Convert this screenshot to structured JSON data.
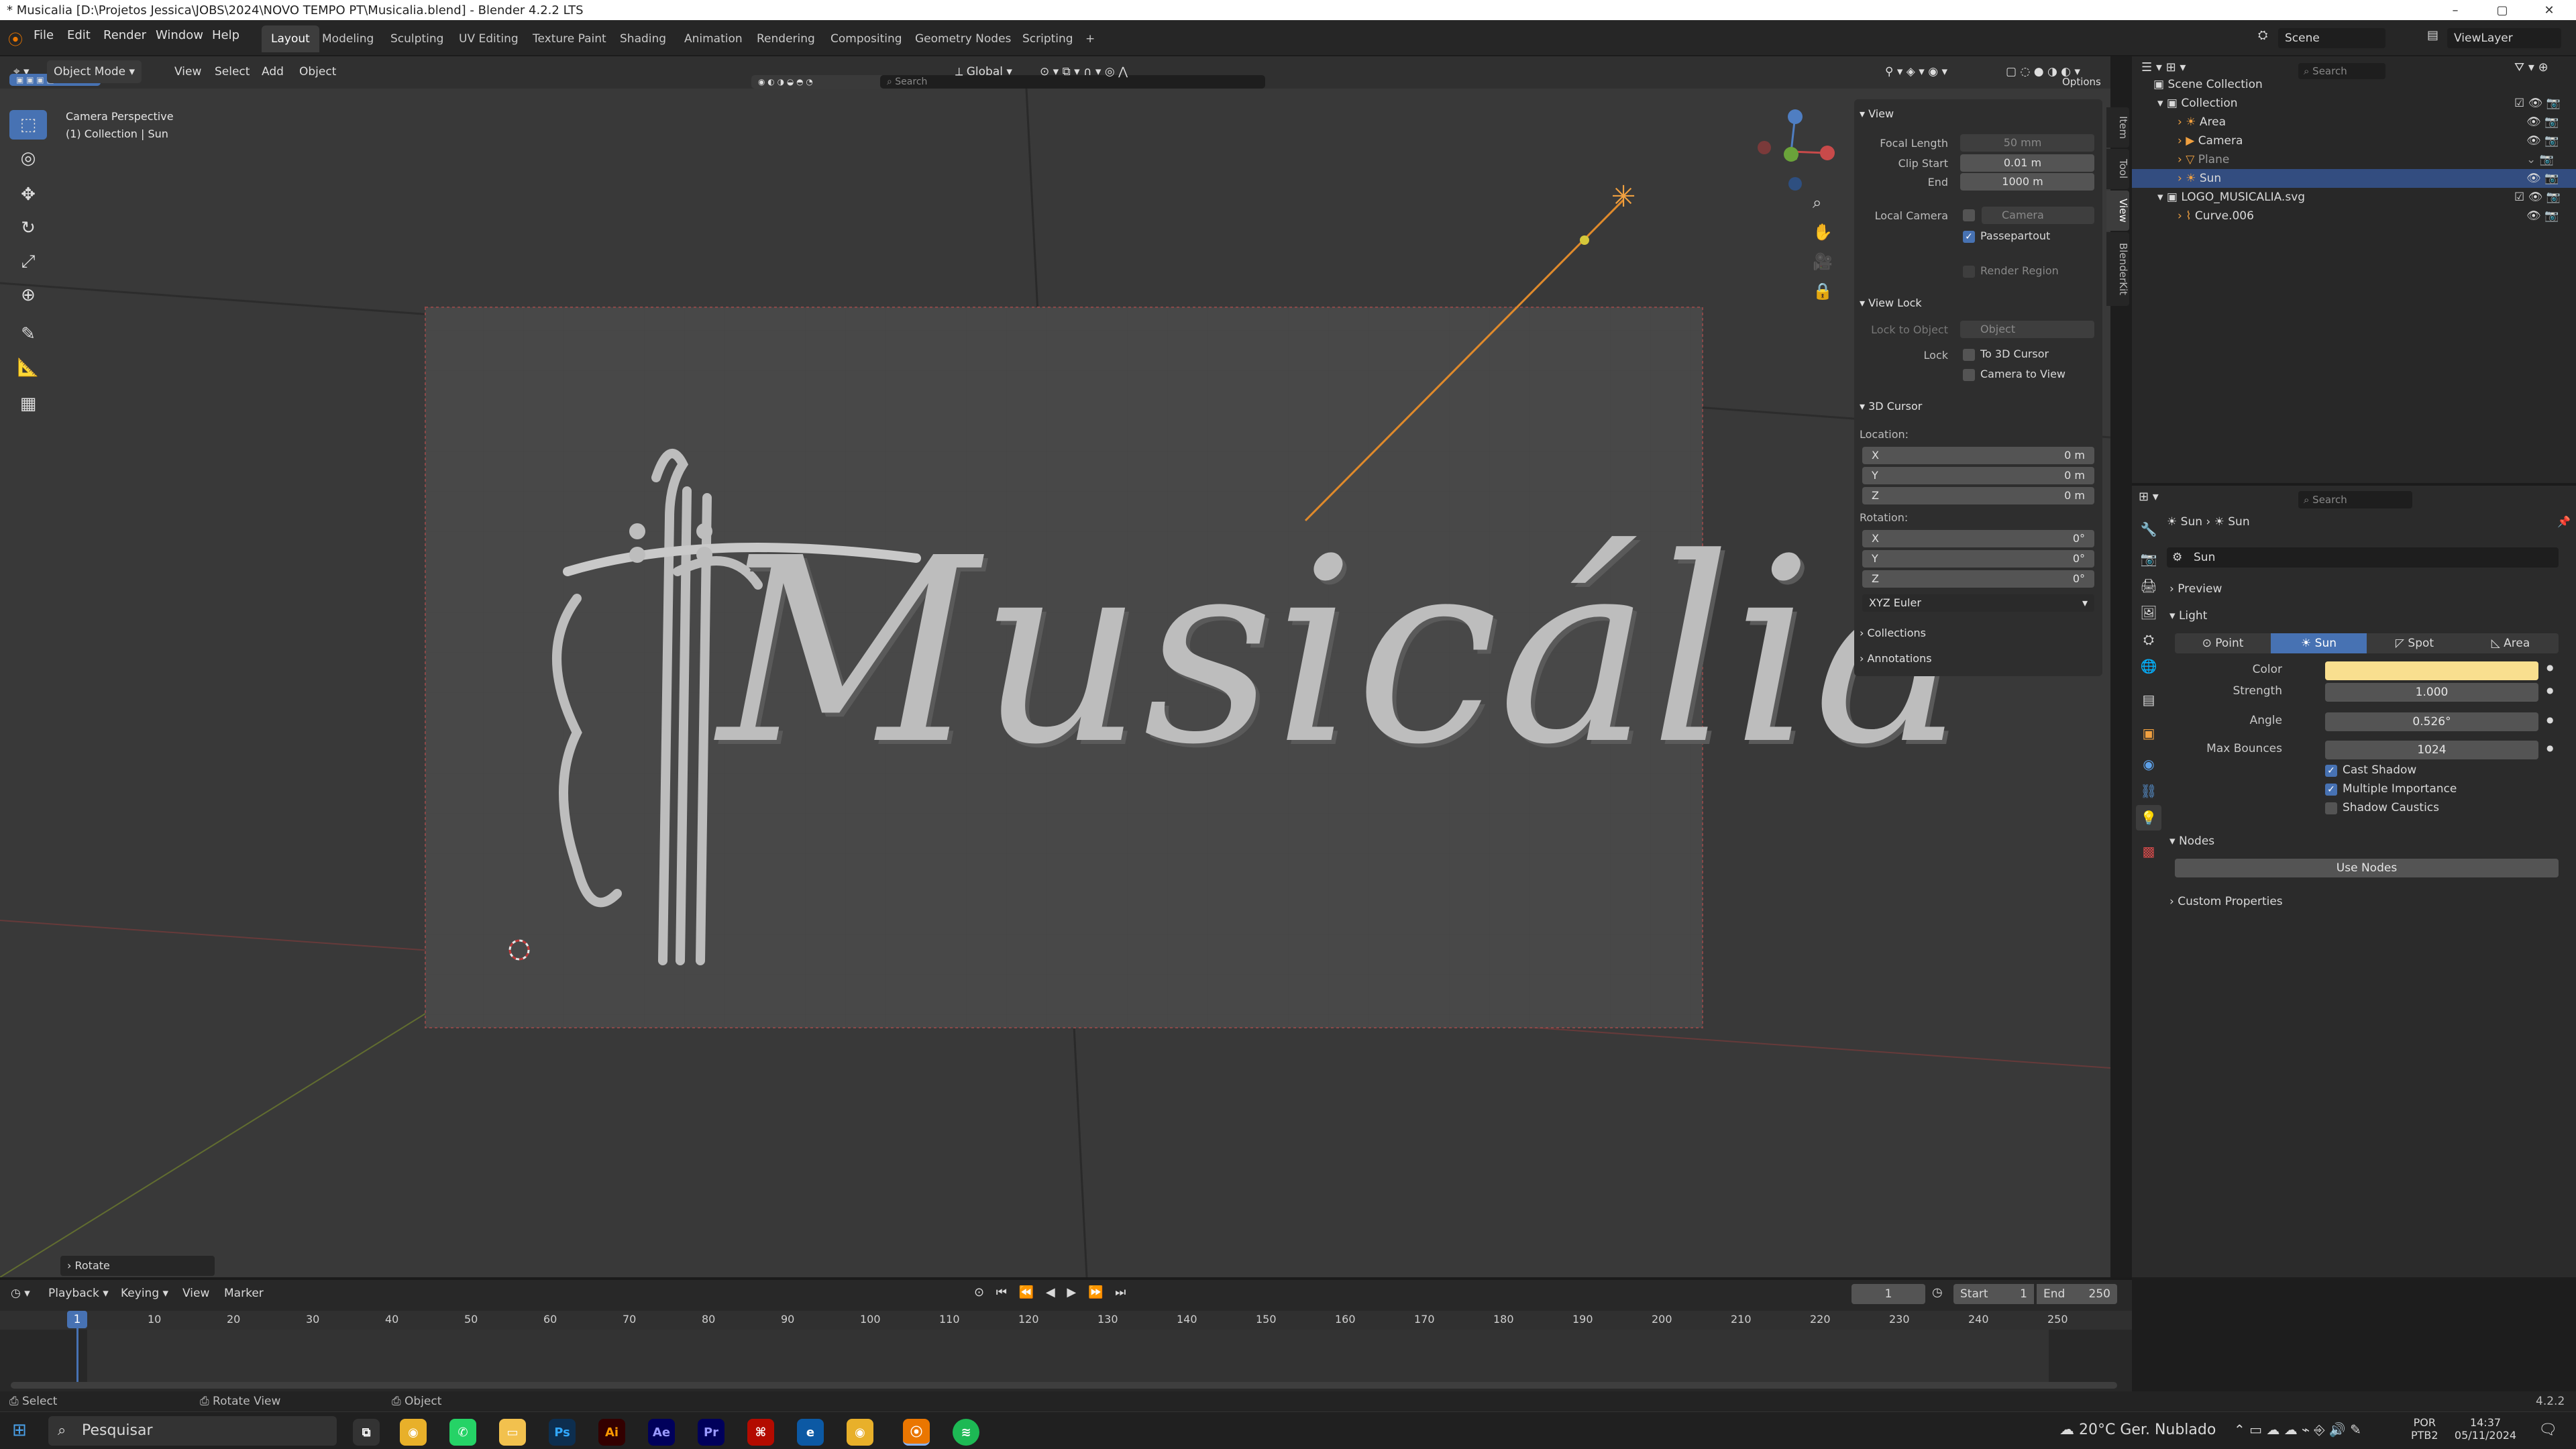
{
  "window": {
    "title": "* Musicalia [D:\\Projetos Jessica\\JOBS\\2024\\NOVO TEMPO PT\\Musicalia.blend] - Blender 4.2.2 LTS",
    "minimize": "–",
    "maximize": "▢",
    "close": "✕"
  },
  "menu": {
    "items": [
      "File",
      "Edit",
      "Render",
      "Window",
      "Help"
    ]
  },
  "workspaces": {
    "tabs": [
      "Layout",
      "Modeling",
      "Sculpting",
      "UV Editing",
      "Texture Paint",
      "Shading",
      "Animation",
      "Rendering",
      "Compositing",
      "Geometry Nodes",
      "Scripting"
    ],
    "active": "Layout",
    "add": "+"
  },
  "topbar_right": {
    "scene": "Scene",
    "viewlayer": "ViewLayer"
  },
  "viewport_header": {
    "mode": "Object Mode",
    "menus": [
      "View",
      "Select",
      "Add",
      "Object"
    ],
    "orientation": "Global",
    "search_placeholder": "Search",
    "options": "Options"
  },
  "viewport": {
    "camera_label": "Camera Perspective",
    "collection_label": "(1) Collection | Sun",
    "logo_text": "Musicália",
    "last_op": "Rotate"
  },
  "npanel": {
    "view_header": "View",
    "focal_length_label": "Focal Length",
    "focal_length": "50 mm",
    "clip_start_label": "Clip Start",
    "clip_start": "0.01 m",
    "end_label": "End",
    "end": "1000 m",
    "local_camera_label": "Local Camera",
    "local_camera_value": "Camera",
    "passepartout": "Passepartout",
    "render_region": "Render Region",
    "view_lock_header": "View Lock",
    "lock_to_object_label": "Lock to Object",
    "lock_to_object_value": "Object",
    "lock_label": "Lock",
    "to_3d_cursor": "To 3D Cursor",
    "camera_to_view": "Camera to View",
    "cursor_header": "3D Cursor",
    "location_label": "Location:",
    "loc_x_label": "X",
    "loc_x": "0 m",
    "loc_y_label": "Y",
    "loc_y": "0 m",
    "loc_z_label": "Z",
    "loc_z": "0 m",
    "rotation_label": "Rotation:",
    "rot_x_label": "X",
    "rot_x": "0°",
    "rot_y_label": "Y",
    "rot_y": "0°",
    "rot_z_label": "Z",
    "rot_z": "0°",
    "euler": "XYZ Euler",
    "collections_header": "Collections",
    "annotations_header": "Annotations",
    "sidetabs": [
      "Item",
      "Tool",
      "View",
      "BlenderKit"
    ],
    "active_sidetab": "View"
  },
  "outliner": {
    "search_placeholder": "Search",
    "scene_collection": "Scene Collection",
    "rows": [
      {
        "name": "Collection",
        "indent": 1
      },
      {
        "name": "Area",
        "indent": 2
      },
      {
        "name": "Camera",
        "indent": 2
      },
      {
        "name": "Plane",
        "indent": 2
      },
      {
        "name": "Sun",
        "indent": 2
      },
      {
        "name": "LOGO_MUSICALIA.svg",
        "indent": 1
      },
      {
        "name": "Curve.006",
        "indent": 2
      }
    ],
    "selected": "Sun"
  },
  "properties": {
    "search_placeholder": "Search",
    "breadcrumb_object": "Sun",
    "breadcrumb_data": "Sun",
    "datablock_name": "Sun",
    "preview_header": "Preview",
    "light_header": "Light",
    "light_types": [
      "Point",
      "Sun",
      "Spot",
      "Area"
    ],
    "light_type_active": "Sun",
    "color_label": "Color",
    "color_value": "#f9df8f",
    "strength_label": "Strength",
    "strength": "1.000",
    "angle_label": "Angle",
    "angle": "0.526°",
    "max_bounces_label": "Max Bounces",
    "max_bounces": "1024",
    "cast_shadow": "Cast Shadow",
    "multiple_importance": "Multiple Importance",
    "shadow_caustics": "Shadow Caustics",
    "nodes_header": "Nodes",
    "use_nodes": "Use Nodes",
    "custom_props_header": "Custom Properties"
  },
  "timeline": {
    "menus": [
      "Playback",
      "Keying",
      "View",
      "Marker"
    ],
    "current_frame": "1",
    "start_label": "Start",
    "start": "1",
    "end_label": "End",
    "end": "250",
    "ticks": [
      "10",
      "20",
      "30",
      "40",
      "50",
      "60",
      "70",
      "80",
      "90",
      "100",
      "110",
      "120",
      "130",
      "140",
      "150",
      "160",
      "170",
      "180",
      "190",
      "200",
      "210",
      "220",
      "230",
      "240",
      "250"
    ],
    "playhead": "1"
  },
  "statusbar": {
    "select": "Select",
    "rotate_view": "Rotate View",
    "object": "Object",
    "version": "4.2.2"
  },
  "taskbar": {
    "search": "Pesquisar",
    "weather": "20°C Ger. Nublado",
    "lang": "POR",
    "lang2": "PTB2",
    "time": "14:37",
    "date": "05/11/2024",
    "apps": [
      "Ps",
      "Ai",
      "Ae",
      "Pr"
    ]
  }
}
